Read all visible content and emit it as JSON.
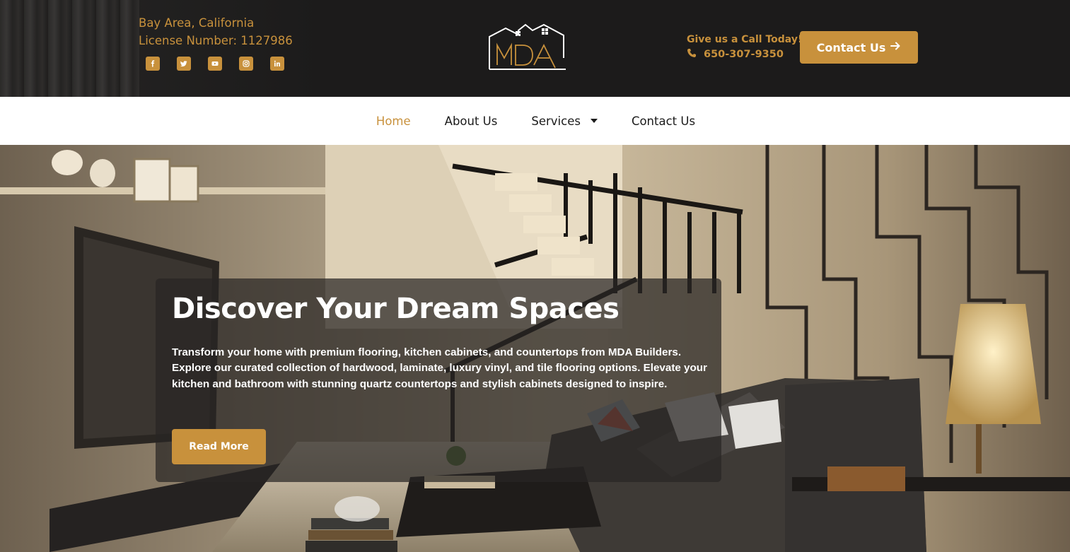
{
  "header": {
    "location": "Bay Area, California",
    "license": "License Number: 1127986",
    "socials": [
      {
        "name": "facebook-icon",
        "glyph": "f"
      },
      {
        "name": "twitter-icon",
        "glyph": "t"
      },
      {
        "name": "youtube-icon",
        "glyph": "▶"
      },
      {
        "name": "instagram-icon",
        "glyph": "◎"
      },
      {
        "name": "linkedin-icon",
        "glyph": "in"
      }
    ],
    "logo_text": "MDA",
    "call_title": "Give us a Call Today!",
    "phone": "650-307-9350",
    "contact_button": "Contact Us"
  },
  "nav": {
    "items": [
      {
        "label": "Home",
        "active": true
      },
      {
        "label": "About Us",
        "active": false
      },
      {
        "label": "Services",
        "active": false,
        "dropdown": true
      },
      {
        "label": "Contact Us",
        "active": false
      }
    ]
  },
  "hero": {
    "title": "Discover Your Dream Spaces",
    "text": "Transform your home with premium flooring, kitchen cabinets, and countertops from MDA Builders. Explore our curated collection of hardwood, laminate, luxury vinyl, and tile flooring options. Elevate your kitchen and bathroom with stunning quartz countertops and stylish cabinets designed to inspire.",
    "button": "Read More"
  },
  "colors": {
    "accent": "#c8913c",
    "topbar": "#1c1b1b",
    "nav_bg": "#ffffff"
  }
}
